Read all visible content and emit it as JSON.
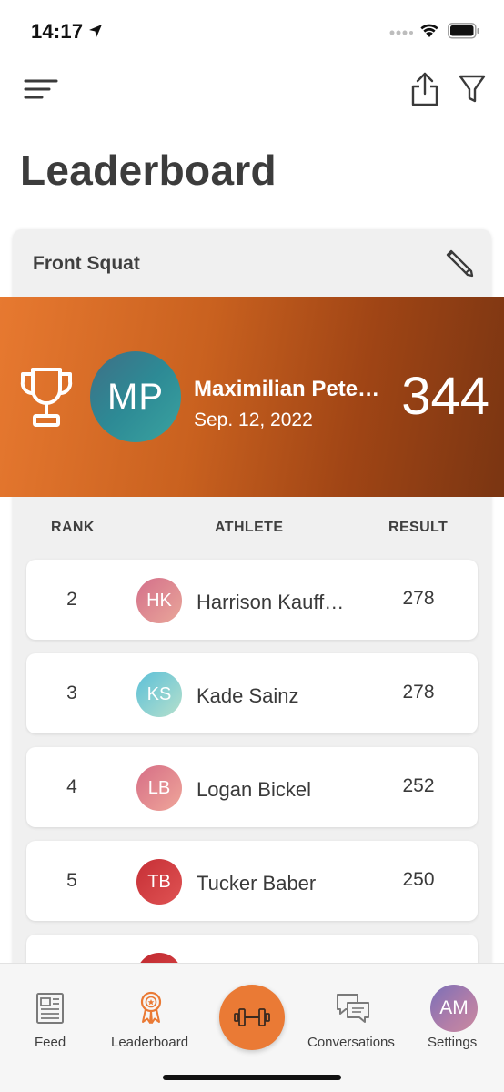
{
  "status_bar": {
    "time": "14:17"
  },
  "header": {
    "title": "Leaderboard"
  },
  "card": {
    "title": "Front Squat"
  },
  "winner": {
    "initials": "MP",
    "name": "Maximilian Petersen",
    "date": "Sep. 12, 2022",
    "result": "344"
  },
  "table": {
    "columns": {
      "rank": "RANK",
      "athlete": "ATHLETE",
      "result": "RESULT"
    },
    "rows": [
      {
        "rank": "2",
        "initials": "HK",
        "name": "Harrison Kauffman",
        "result": "278",
        "avatar_color": "#e08a95"
      },
      {
        "rank": "3",
        "initials": "KS",
        "name": "Kade Sainz",
        "result": "278",
        "avatar_color": "#7fc9d0"
      },
      {
        "rank": "4",
        "initials": "LB",
        "name": "Logan Bickel",
        "result": "252",
        "avatar_color": "#e48a95"
      },
      {
        "rank": "5",
        "initials": "TB",
        "name": "Tucker Baber",
        "result": "250",
        "avatar_color": "#cf3b3f"
      },
      {
        "rank": "",
        "initials": "",
        "name": "",
        "result": "",
        "avatar_color": "#c8353a"
      }
    ]
  },
  "tab_bar": {
    "feed": "Feed",
    "leaderboard": "Leaderboard",
    "conversations": "Conversations",
    "settings": "Settings",
    "settings_initials": "AM"
  },
  "colors": {
    "accent": "#ea7a35",
    "winner_start": "#e77930",
    "winner_end": "#7a3512"
  },
  "icons": {
    "menu": "menu-icon",
    "share": "share-icon",
    "filter": "filter-icon",
    "edit": "pencil-icon",
    "trophy": "trophy-icon",
    "feed": "newspaper-icon",
    "leaderboard": "award-ribbon-icon",
    "workout": "dumbbell-icon",
    "conversations": "chat-bubbles-icon"
  }
}
